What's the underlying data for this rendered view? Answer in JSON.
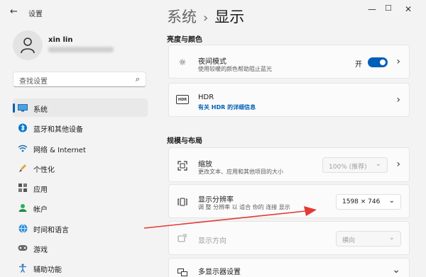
{
  "window": {
    "back_icon": "back-arrow-icon",
    "title": "设置",
    "controls": [
      "minimize",
      "maximize",
      "close"
    ]
  },
  "user": {
    "name": "xin lin"
  },
  "search": {
    "placeholder": "查找设置"
  },
  "sidebar": {
    "items": [
      {
        "label": "系统",
        "icon": "monitor-icon",
        "active": true
      },
      {
        "label": "蓝牙和其他设备",
        "icon": "bluetooth-icon"
      },
      {
        "label": "网络 & Internet",
        "icon": "wifi-icon"
      },
      {
        "label": "个性化",
        "icon": "brush-icon"
      },
      {
        "label": "应用",
        "icon": "apps-icon"
      },
      {
        "label": "帐户",
        "icon": "account-icon"
      },
      {
        "label": "时间和语言",
        "icon": "globe-clock-icon"
      },
      {
        "label": "游戏",
        "icon": "gamepad-icon"
      },
      {
        "label": "辅助功能",
        "icon": "accessibility-icon"
      }
    ]
  },
  "breadcrumb": {
    "parent": "系统",
    "separator": "›",
    "current": "显示"
  },
  "sections": {
    "brightness_color": "亮度与颜色",
    "scale_layout": "规模与布局"
  },
  "cards": {
    "night_light": {
      "title": "夜间模式",
      "desc": "使用较暖的颜色帮助阻止蓝光",
      "toggle_label": "开",
      "toggle_on": true
    },
    "hdr": {
      "title": "HDR",
      "link": "有关 HDR 的详细信息",
      "icon_text": "HDR"
    },
    "scale": {
      "title": "缩放",
      "desc": "更改文本、应用和其他项目的大小",
      "value": "100% (推荐)"
    },
    "resolution": {
      "title": "显示分辨率",
      "desc": "调 整 分辨率 以 适合 你的 连接 显示",
      "value": "1598 × 746"
    },
    "orientation": {
      "title": "显示方向",
      "value": "横向"
    },
    "multi_display": {
      "title": "多显示器设置"
    }
  },
  "colors": {
    "accent": "#005fb8",
    "annotation_arrow": "#e53935"
  }
}
